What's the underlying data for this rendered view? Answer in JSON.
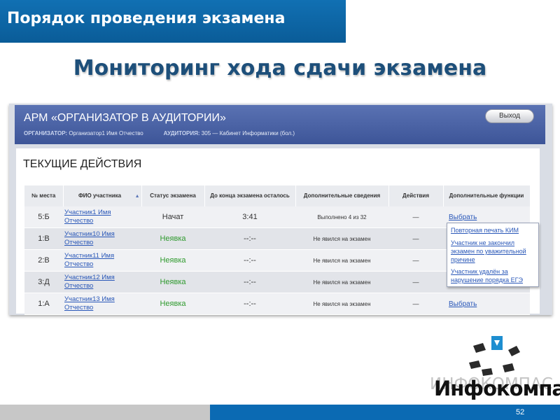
{
  "slide": {
    "header": "Порядок проведения экзамена",
    "subtitle": "Мониторинг хода сдачи экзамена",
    "page_number": "52"
  },
  "app": {
    "title": "АРМ «ОРГАНИЗАТОР В АУДИТОРИИ»",
    "exit_label": "Выход",
    "organizer_label": "ОРГАНИЗАТОР:",
    "organizer_value": "Организатор1 Имя Отчество",
    "room_label": "АУДИТОРИЯ:",
    "room_value": "305 — Кабинет Информатики (бол.)",
    "section_title": "ТЕКУЩИЕ ДЕЙСТВИЯ",
    "columns": [
      "№ места",
      "ФИО участника",
      "Статус экзамена",
      "До конца экзамена осталось",
      "Дополнительные сведения",
      "Действия",
      "Дополнительные функции"
    ],
    "rows": [
      {
        "seat": "5:Б",
        "name1": "Участник1 Имя",
        "name2": "Отчество",
        "status": "Начат",
        "time": "3:41",
        "info": "Выполнено 4 из 32",
        "action": "—",
        "func": "Выбрать"
      },
      {
        "seat": "1:В",
        "name1": "Участник10 Имя",
        "name2": "Отчество",
        "status": "Неявка",
        "time": "--:--",
        "info": "Не явился на экзамен",
        "action": "—",
        "func": ""
      },
      {
        "seat": "2:В",
        "name1": "Участник11 Имя",
        "name2": "Отчество",
        "status": "Неявка",
        "time": "--:--",
        "info": "Не явился на экзамен",
        "action": "—",
        "func": ""
      },
      {
        "seat": "3:Д",
        "name1": "Участник12 Имя",
        "name2": "Отчество",
        "status": "Неявка",
        "time": "--:--",
        "info": "Не явился на экзамен",
        "action": "—",
        "func": ""
      },
      {
        "seat": "1:А",
        "name1": "Участник13 Имя",
        "name2": "Отчество",
        "status": "Неявка",
        "time": "--:--",
        "info": "Не явился на экзамен",
        "action": "—",
        "func": "Выбрать"
      }
    ],
    "dropdown": [
      "Повторная печать КИМ",
      "Участник не закончил",
      "экзамен по уважительной",
      "причине",
      "Участник удалён за",
      "нарушение порядка ЕГЭ"
    ]
  },
  "logo": {
    "text": "Инфокомпас",
    "shadow_text": "ИНФОКОМПАС"
  },
  "colors": {
    "header_blue": "#0a5c98",
    "app_bar": "#4a62a5",
    "link": "#2957b8",
    "absent_green": "#2f9a2e"
  }
}
